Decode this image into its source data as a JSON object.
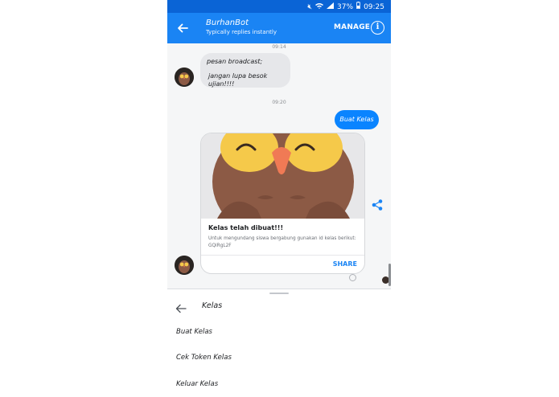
{
  "status_bar": {
    "battery": "37%",
    "time": "09:25"
  },
  "header": {
    "title": "BurhanBot",
    "subtitle": "Typically replies instantly",
    "manage_label": "MANAGE"
  },
  "chat": {
    "timestamp_1": "09:14",
    "incoming_line_1": "pesan broadcast;",
    "incoming_line_2": "jangan lupa besok ujian!!!!",
    "timestamp_2": "09:20",
    "outgoing_text": "Buat Kelas",
    "card": {
      "title": "Kelas telah dibuat!!!",
      "description": "Untuk mengundang siswa bergabung gunakan id kelas berikut: GQiRgL2F",
      "share_label": "SHARE"
    }
  },
  "menu": {
    "title": "Kelas",
    "items": [
      "Buat Kelas",
      "Cek Token Kelas",
      "Keluar Kelas"
    ]
  },
  "colors": {
    "header_blue": "#1a84f4",
    "status_blue": "#0a64d6",
    "bubble_blue": "#0a84ff",
    "owl_brown": "#8c5a45",
    "owl_beak": "#f07a55",
    "owl_eye_area": "#f5c94a"
  }
}
